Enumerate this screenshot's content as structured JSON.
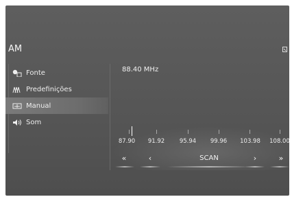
{
  "screen": {
    "title": "AM"
  },
  "sidebar": {
    "items": [
      {
        "label": "Fonte",
        "icon": "source-icon"
      },
      {
        "label": "Predefinições",
        "icon": "presets-icon"
      },
      {
        "label": "Manual",
        "icon": "manual-icon",
        "active": true
      },
      {
        "label": "Som",
        "icon": "speaker-icon"
      }
    ]
  },
  "tuner": {
    "frequency": "88.40 MHz",
    "scale": [
      "87.90",
      "91.92",
      "95.94",
      "99.96",
      "103.98",
      "108.00"
    ]
  },
  "controls": {
    "seek_down": "«",
    "step_down": "‹",
    "scan_label": "SCAN",
    "step_up": "›",
    "seek_up": "»"
  }
}
